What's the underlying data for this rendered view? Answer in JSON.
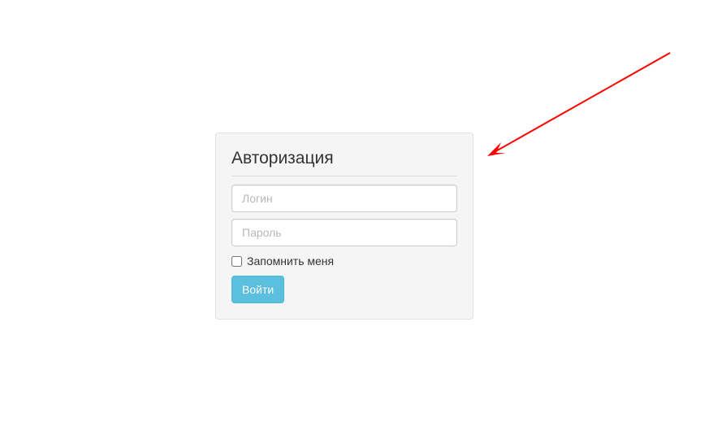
{
  "login": {
    "title": "Авторизация",
    "username_placeholder": "Логин",
    "password_placeholder": "Пароль",
    "remember_label": "Запомнить меня",
    "submit_label": "Войти"
  },
  "annotation": {
    "arrow_color": "#ff0000"
  }
}
